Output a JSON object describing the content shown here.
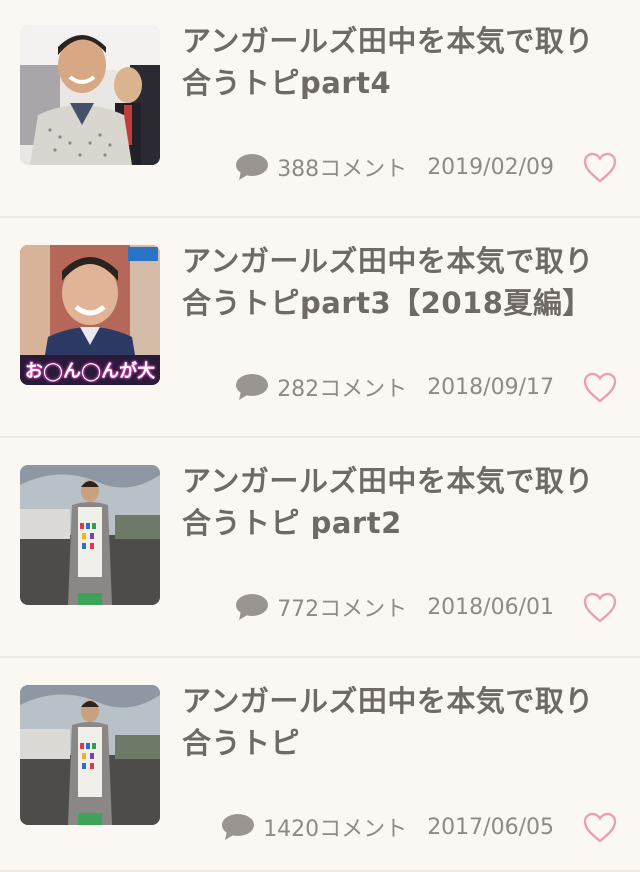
{
  "topics": [
    {
      "title": "アンガールズ田中を本気で取り合うトピpart4",
      "comments": "388コメント",
      "date": "2019/02/09",
      "thumb_icon": "photo-smiling-man-icon"
    },
    {
      "title": "アンガールズ田中を本気で取り合うトピpart3【2018夏編】",
      "comments": "282コメント",
      "date": "2018/09/17",
      "thumb_icon": "photo-tv-still-icon",
      "thumb_caption": "お◯ん◯んが大"
    },
    {
      "title": "アンガールズ田中を本気で取り合うトピ part2",
      "comments": "772コメント",
      "date": "2018/06/01",
      "thumb_icon": "photo-standing-man-icon"
    },
    {
      "title": "アンガールズ田中を本気で取り合うトピ",
      "comments": "1420コメント",
      "date": "2017/06/05",
      "thumb_icon": "photo-standing-man-icon"
    }
  ],
  "colors": {
    "background": "#fbf8f4",
    "title": "#6f6a66",
    "meta": "#8f8a86",
    "heart": "#e7a3b2",
    "divider": "#efe9e4"
  }
}
